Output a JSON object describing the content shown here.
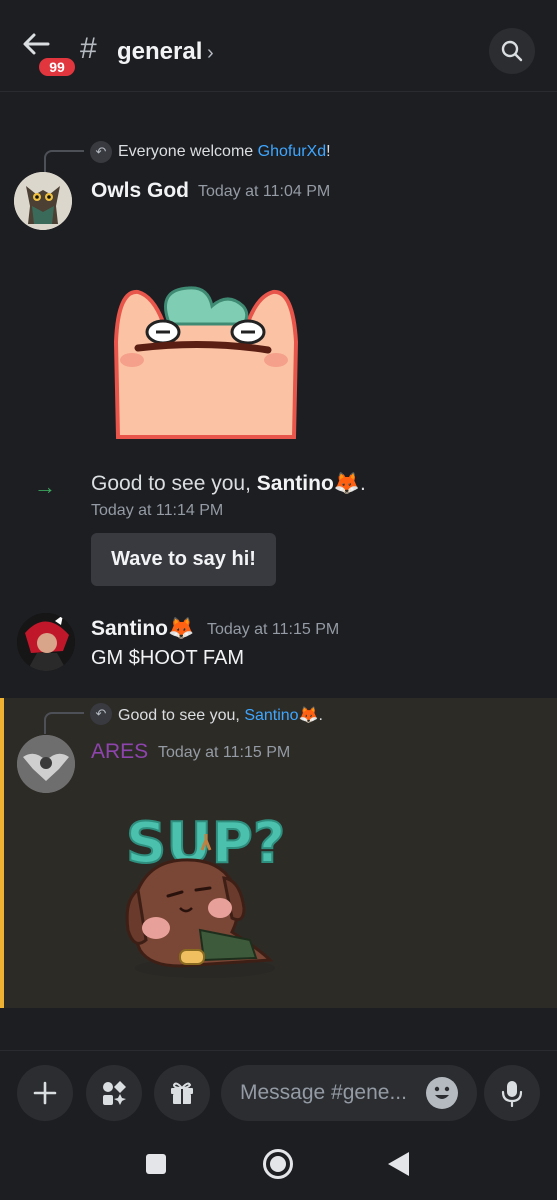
{
  "header": {
    "unread_count": "99",
    "channel_hash": "#",
    "channel_name": "general",
    "chevron": "›"
  },
  "messages": [
    {
      "reply_text": "Everyone welcome ",
      "reply_mention": "GhofurXd",
      "reply_suffix": "!",
      "author": "Owls God",
      "time": "Today at 11:04 PM"
    },
    {
      "system_prefix": "Good to see you, ",
      "system_name": "Santino🦊",
      "system_suffix": ".",
      "time": "Today at 11:14 PM",
      "wave_label": "Wave to say hi!"
    },
    {
      "author": "Santino🦊",
      "time": "Today at 11:15 PM",
      "text": "GM $HOOT FAM"
    },
    {
      "reply_text": "Good to see you, ",
      "reply_mention": "Santino🦊",
      "reply_suffix": ".",
      "author": "ARES",
      "author_color": "#8e44ad",
      "time": "Today at 11:15 PM",
      "sticker_text": "SUP?"
    }
  ],
  "composer": {
    "placeholder": "Message #gene..."
  },
  "colors": {
    "accent_highlight": "#f0b232",
    "mention": "#3ea6ff",
    "badge": "#e2363f"
  }
}
